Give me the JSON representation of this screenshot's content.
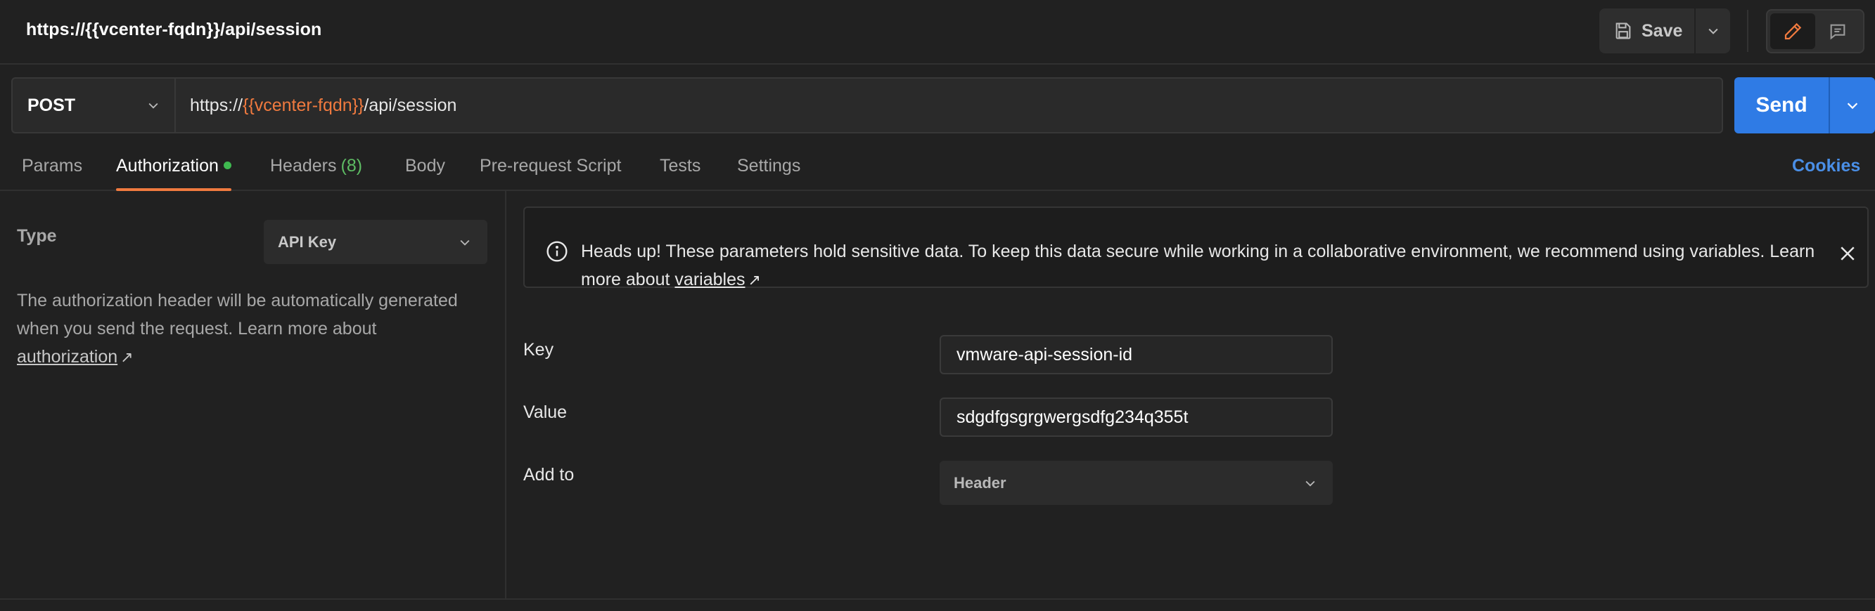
{
  "request": {
    "title": "https://{{vcenter-fqdn}}/api/session",
    "method": "POST",
    "url_prefix": "https://",
    "url_variable": "{{vcenter-fqdn}}",
    "url_suffix": "/api/session"
  },
  "toolbar": {
    "save_label": "Save",
    "send_label": "Send"
  },
  "tabs": [
    {
      "label": "Params"
    },
    {
      "label": "Authorization",
      "active": true,
      "has_indicator": true
    },
    {
      "label": "Headers",
      "count": "(8)"
    },
    {
      "label": "Body"
    },
    {
      "label": "Pre-request Script"
    },
    {
      "label": "Tests"
    },
    {
      "label": "Settings"
    }
  ],
  "cookies_label": "Cookies",
  "auth": {
    "type_label": "Type",
    "type_value": "API Key",
    "help_text": "The authorization header will be automatically generated when you send the request. Learn more about ",
    "help_link": "authorization"
  },
  "banner": {
    "text": "Heads up! These parameters hold sensitive data. To keep this data secure while working in a collaborative environment, we recommend using variables. Learn more about ",
    "link": "variables"
  },
  "fields": {
    "key_label": "Key",
    "key_value": "vmware-api-session-id",
    "value_label": "Value",
    "value_value": "sdgdfgsgrgwergsdfg234q355t",
    "addto_label": "Add to",
    "addto_value": "Header"
  },
  "colors": {
    "accent_orange": "#f07a3f",
    "send_blue": "#2f7be5",
    "indicator_green": "#3fb950",
    "link_blue": "#4a8fe7"
  },
  "icons": {
    "save": "floppy-disk-icon",
    "edit": "pencil-icon",
    "comment": "comment-icon",
    "info": "info-icon",
    "close": "close-icon"
  }
}
